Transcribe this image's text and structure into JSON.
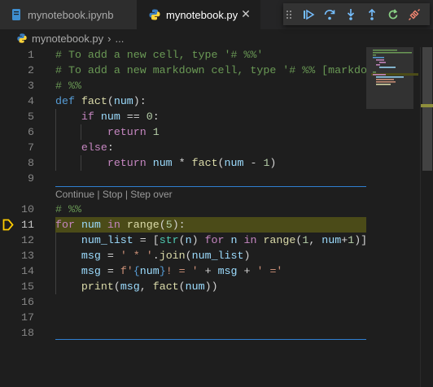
{
  "tabs": [
    {
      "label": "mynotebook.ipynb",
      "active": false
    },
    {
      "label": "mynotebook.py",
      "active": true
    }
  ],
  "tab_close_glyph": "✕",
  "breadcrumb": {
    "file": "mynotebook.py",
    "separator": "›",
    "rest": "..."
  },
  "debug_toolbar": {
    "buttons": [
      "continue-icon",
      "step-over-icon",
      "step-into-icon",
      "step-out-icon",
      "restart-icon",
      "disconnect-icon"
    ]
  },
  "codelens": "Continue | Stop | Step over",
  "current_line": 11,
  "lines": [
    {
      "n": "1",
      "tokens": [
        {
          "t": "# To add a new cell, type '# %%'",
          "c": "com"
        }
      ]
    },
    {
      "n": "2",
      "tokens": [
        {
          "t": "# To add a new markdown cell, type '# %% [markdown]'",
          "c": "com"
        }
      ]
    },
    {
      "n": "3",
      "tokens": [
        {
          "t": "# %%",
          "c": "com"
        }
      ]
    },
    {
      "n": "4",
      "tokens": [
        {
          "t": "def",
          "c": "def"
        },
        {
          "t": " ",
          "c": "op"
        },
        {
          "t": "fact",
          "c": "fn"
        },
        {
          "t": "(",
          "c": "op"
        },
        {
          "t": "num",
          "c": "var"
        },
        {
          "t": "):",
          "c": "op"
        }
      ]
    },
    {
      "n": "5",
      "tokens": [
        {
          "t": "    ",
          "c": "op"
        },
        {
          "t": "if",
          "c": "kw"
        },
        {
          "t": " ",
          "c": "op"
        },
        {
          "t": "num",
          "c": "var"
        },
        {
          "t": " == ",
          "c": "op"
        },
        {
          "t": "0",
          "c": "num"
        },
        {
          "t": ":",
          "c": "op"
        }
      ]
    },
    {
      "n": "6",
      "tokens": [
        {
          "t": "        ",
          "c": "op"
        },
        {
          "t": "return",
          "c": "kw"
        },
        {
          "t": " ",
          "c": "op"
        },
        {
          "t": "1",
          "c": "num"
        }
      ]
    },
    {
      "n": "7",
      "tokens": [
        {
          "t": "    ",
          "c": "op"
        },
        {
          "t": "else",
          "c": "kw"
        },
        {
          "t": ":",
          "c": "op"
        }
      ]
    },
    {
      "n": "8",
      "tokens": [
        {
          "t": "        ",
          "c": "op"
        },
        {
          "t": "return",
          "c": "kw"
        },
        {
          "t": " ",
          "c": "op"
        },
        {
          "t": "num",
          "c": "var"
        },
        {
          "t": " * ",
          "c": "op"
        },
        {
          "t": "fact",
          "c": "fn"
        },
        {
          "t": "(",
          "c": "op"
        },
        {
          "t": "num",
          "c": "var"
        },
        {
          "t": " - ",
          "c": "op"
        },
        {
          "t": "1",
          "c": "num"
        },
        {
          "t": ")",
          "c": "op"
        }
      ]
    },
    {
      "n": "9",
      "tokens": []
    },
    {
      "n": "10",
      "tokens": [
        {
          "t": "# %%",
          "c": "com"
        }
      ]
    },
    {
      "n": "11",
      "tokens": [
        {
          "t": "for",
          "c": "kw"
        },
        {
          "t": " ",
          "c": "op"
        },
        {
          "t": "num",
          "c": "var"
        },
        {
          "t": " ",
          "c": "op"
        },
        {
          "t": "in",
          "c": "kw"
        },
        {
          "t": " ",
          "c": "op"
        },
        {
          "t": "range",
          "c": "fn"
        },
        {
          "t": "(",
          "c": "op"
        },
        {
          "t": "5",
          "c": "num"
        },
        {
          "t": "):",
          "c": "op"
        }
      ]
    },
    {
      "n": "12",
      "tokens": [
        {
          "t": "    ",
          "c": "op"
        },
        {
          "t": "num_list",
          "c": "var"
        },
        {
          "t": " = [",
          "c": "op"
        },
        {
          "t": "str",
          "c": "cls"
        },
        {
          "t": "(",
          "c": "op"
        },
        {
          "t": "n",
          "c": "var"
        },
        {
          "t": ") ",
          "c": "op"
        },
        {
          "t": "for",
          "c": "kw"
        },
        {
          "t": " ",
          "c": "op"
        },
        {
          "t": "n",
          "c": "var"
        },
        {
          "t": " ",
          "c": "op"
        },
        {
          "t": "in",
          "c": "kw"
        },
        {
          "t": " ",
          "c": "op"
        },
        {
          "t": "range",
          "c": "fn"
        },
        {
          "t": "(",
          "c": "op"
        },
        {
          "t": "1",
          "c": "num"
        },
        {
          "t": ", ",
          "c": "op"
        },
        {
          "t": "num",
          "c": "var"
        },
        {
          "t": "+",
          "c": "op"
        },
        {
          "t": "1",
          "c": "num"
        },
        {
          "t": ")]",
          "c": "op"
        }
      ]
    },
    {
      "n": "13",
      "tokens": [
        {
          "t": "    ",
          "c": "op"
        },
        {
          "t": "msg",
          "c": "var"
        },
        {
          "t": " = ",
          "c": "op"
        },
        {
          "t": "' * '",
          "c": "str"
        },
        {
          "t": ".",
          "c": "op"
        },
        {
          "t": "join",
          "c": "fn"
        },
        {
          "t": "(",
          "c": "op"
        },
        {
          "t": "num_list",
          "c": "var"
        },
        {
          "t": ")",
          "c": "op"
        }
      ]
    },
    {
      "n": "14",
      "tokens": [
        {
          "t": "    ",
          "c": "op"
        },
        {
          "t": "msg",
          "c": "var"
        },
        {
          "t": " = ",
          "c": "op"
        },
        {
          "t": "f'",
          "c": "str"
        },
        {
          "t": "{",
          "c": "def"
        },
        {
          "t": "num",
          "c": "var"
        },
        {
          "t": "}",
          "c": "def"
        },
        {
          "t": "! = '",
          "c": "str"
        },
        {
          "t": " + ",
          "c": "op"
        },
        {
          "t": "msg",
          "c": "var"
        },
        {
          "t": " + ",
          "c": "op"
        },
        {
          "t": "' ='",
          "c": "str"
        }
      ]
    },
    {
      "n": "15",
      "tokens": [
        {
          "t": "    ",
          "c": "op"
        },
        {
          "t": "print",
          "c": "fn"
        },
        {
          "t": "(",
          "c": "op"
        },
        {
          "t": "msg",
          "c": "var"
        },
        {
          "t": ", ",
          "c": "op"
        },
        {
          "t": "fact",
          "c": "fn"
        },
        {
          "t": "(",
          "c": "op"
        },
        {
          "t": "num",
          "c": "var"
        },
        {
          "t": "))",
          "c": "op"
        }
      ]
    },
    {
      "n": "16",
      "tokens": []
    },
    {
      "n": "17",
      "tokens": []
    },
    {
      "n": "18",
      "tokens": []
    }
  ],
  "colors": {
    "editor_bg": "#1e1e1e",
    "current_line_highlight": "#4b4b18",
    "debug_arrow": "#ffcc00",
    "cell_divider": "#2f7fd0",
    "debug_blue": "#75beff",
    "debug_green": "#89d185",
    "debug_red": "#f48771"
  }
}
